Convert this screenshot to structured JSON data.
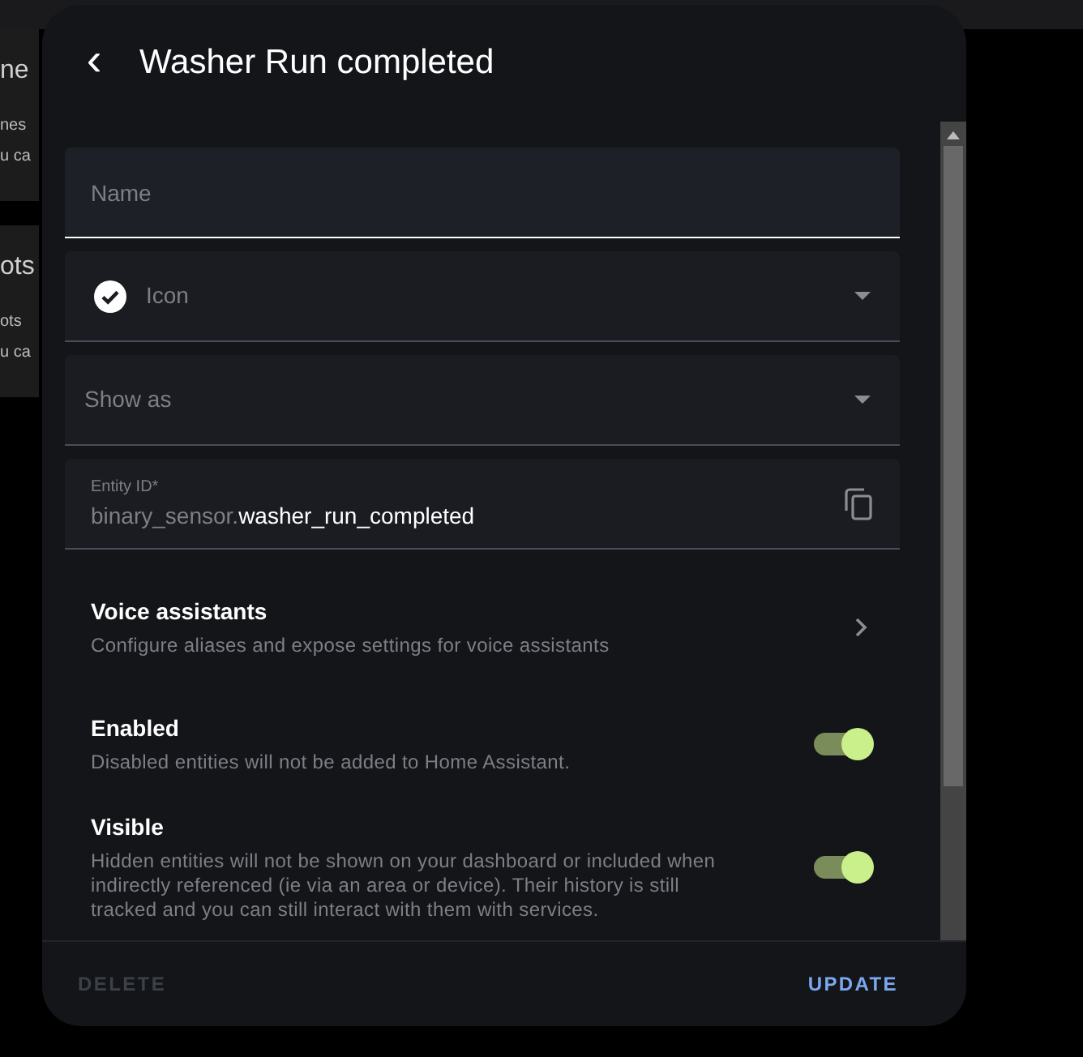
{
  "background": {
    "cards": [
      {
        "heading": "ne",
        "lines": [
          "nes",
          "u ca"
        ]
      },
      {
        "heading": "ots",
        "lines": [
          "ots",
          "u ca"
        ]
      }
    ]
  },
  "dialog": {
    "back": "‹",
    "title": "Washer Run completed",
    "fields": [
      {
        "kind": "input",
        "placeholder": "Name",
        "focused": true
      },
      {
        "kind": "icon-select",
        "label": "Icon",
        "focused": false
      },
      {
        "kind": "select",
        "label": "Show as",
        "focused": false
      },
      {
        "kind": "entity",
        "label": "Entity ID*",
        "prefix": "binary_sensor.",
        "value": "washer_run_completed",
        "focused": false
      }
    ],
    "rows": [
      {
        "kind": "link",
        "title": "Voice assistants",
        "description": "Configure aliases and expose settings for voice assistants"
      },
      {
        "kind": "toggle",
        "title": "Enabled",
        "description": "Disabled entities will not be added to Home Assistant.",
        "on": true
      },
      {
        "kind": "toggle",
        "title": "Visible",
        "description": "Hidden entities will not be shown on your dashboard or included when indirectly referenced (ie via an area or device). Their history is still tracked and you can still interact with them with services.",
        "on": true
      }
    ],
    "buttons": [
      {
        "label": "DELETE",
        "disabled": true
      },
      {
        "label": "UPDATE",
        "disabled": false
      }
    ]
  }
}
